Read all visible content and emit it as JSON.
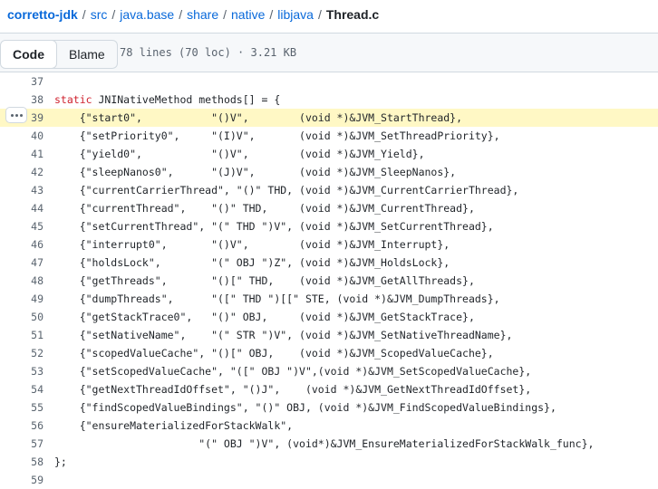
{
  "breadcrumb": {
    "repo": "corretto-jdk",
    "path": [
      "src",
      "java.base",
      "share",
      "native",
      "libjava"
    ],
    "file": "Thread.c",
    "separator": "/"
  },
  "toolbar": {
    "code_label": "Code",
    "blame_label": "Blame",
    "file_info": "78 lines (70 loc) · 3.21 KB"
  },
  "code_lines": [
    {
      "n": "37",
      "pre": "",
      "kw": "",
      "rest": ""
    },
    {
      "n": "38",
      "pre": "",
      "kw": "static",
      "rest": " JNINativeMethod methods[] = {"
    },
    {
      "n": "39",
      "pre": "    {\"start0\",           \"()V\",        (void *)&JVM_StartThread},",
      "kw": "",
      "rest": ""
    },
    {
      "n": "40",
      "pre": "    {\"setPriority0\",     \"(I)V\",       (void *)&JVM_SetThreadPriority},",
      "kw": "",
      "rest": ""
    },
    {
      "n": "41",
      "pre": "    {\"yield0\",           \"()V\",        (void *)&JVM_Yield},",
      "kw": "",
      "rest": ""
    },
    {
      "n": "42",
      "pre": "    {\"sleepNanos0\",      \"(J)V\",       (void *)&JVM_SleepNanos},",
      "kw": "",
      "rest": ""
    },
    {
      "n": "43",
      "pre": "    {\"currentCarrierThread\", \"()\" THD, (void *)&JVM_CurrentCarrierThread},",
      "kw": "",
      "rest": ""
    },
    {
      "n": "44",
      "pre": "    {\"currentThread\",    \"()\" THD,     (void *)&JVM_CurrentThread},",
      "kw": "",
      "rest": ""
    },
    {
      "n": "45",
      "pre": "    {\"setCurrentThread\", \"(\" THD \")V\", (void *)&JVM_SetCurrentThread},",
      "kw": "",
      "rest": ""
    },
    {
      "n": "46",
      "pre": "    {\"interrupt0\",       \"()V\",        (void *)&JVM_Interrupt},",
      "kw": "",
      "rest": ""
    },
    {
      "n": "47",
      "pre": "    {\"holdsLock\",        \"(\" OBJ \")Z\", (void *)&JVM_HoldsLock},",
      "kw": "",
      "rest": ""
    },
    {
      "n": "48",
      "pre": "    {\"getThreads\",       \"()[\" THD,    (void *)&JVM_GetAllThreads},",
      "kw": "",
      "rest": ""
    },
    {
      "n": "49",
      "pre": "    {\"dumpThreads\",      \"([\" THD \")[[\" STE, (void *)&JVM_DumpThreads},",
      "kw": "",
      "rest": ""
    },
    {
      "n": "50",
      "pre": "    {\"getStackTrace0\",   \"()\" OBJ,     (void *)&JVM_GetStackTrace},",
      "kw": "",
      "rest": ""
    },
    {
      "n": "51",
      "pre": "    {\"setNativeName\",    \"(\" STR \")V\", (void *)&JVM_SetNativeThreadName},",
      "kw": "",
      "rest": ""
    },
    {
      "n": "52",
      "pre": "    {\"scopedValueCache\", \"()[\" OBJ,    (void *)&JVM_ScopedValueCache},",
      "kw": "",
      "rest": ""
    },
    {
      "n": "53",
      "pre": "    {\"setScopedValueCache\", \"([\" OBJ \")V\",(void *)&JVM_SetScopedValueCache},",
      "kw": "",
      "rest": ""
    },
    {
      "n": "54",
      "pre": "    {\"getNextThreadIdOffset\", \"()J\",    (void *)&JVM_GetNextThreadIdOffset},",
      "kw": "",
      "rest": ""
    },
    {
      "n": "55",
      "pre": "    {\"findScopedValueBindings\", \"()\" OBJ, (void *)&JVM_FindScopedValueBindings},",
      "kw": "",
      "rest": ""
    },
    {
      "n": "56",
      "pre": "    {\"ensureMaterializedForStackWalk\",",
      "kw": "",
      "rest": ""
    },
    {
      "n": "57",
      "pre": "                       \"(\" OBJ \")V\", (void*)&JVM_EnsureMaterializedForStackWalk_func},",
      "kw": "",
      "rest": ""
    },
    {
      "n": "58",
      "pre": "};",
      "kw": "",
      "rest": ""
    },
    {
      "n": "59",
      "pre": "",
      "kw": "",
      "rest": ""
    }
  ],
  "highlighted_line": "39",
  "colors": {
    "link": "#0969da",
    "keyword": "#cf222e",
    "highlight": "#fff8c5"
  }
}
